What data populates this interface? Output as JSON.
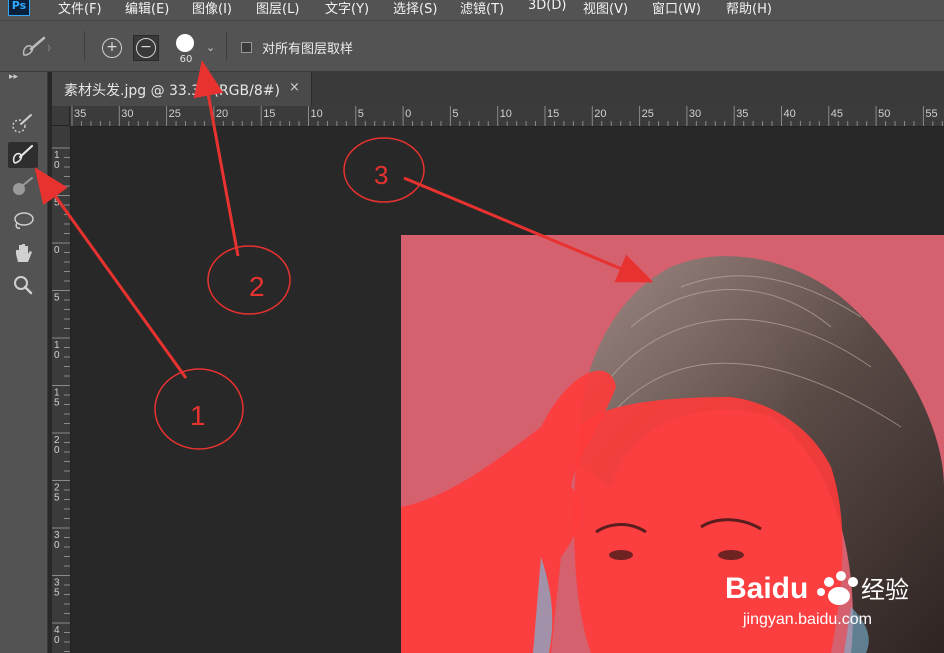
{
  "app": {
    "logo": "Ps"
  },
  "menu": [
    "文件(F)",
    "编辑(E)",
    "图像(I)",
    "图层(L)",
    "文字(Y)",
    "选择(S)",
    "滤镜(T)",
    "3D(D)",
    "视图(V)",
    "窗口(W)",
    "帮助(H)"
  ],
  "options": {
    "brush_size": "60",
    "sample_all_layers_label": "对所有图层取样",
    "sample_all_layers_checked": false
  },
  "document_tab": {
    "title": "素材头发.jpg @ 33.3%(RGB/8#)",
    "close_symbol": "×"
  },
  "rulers": {
    "top_labels": [
      "35",
      "30",
      "25",
      "20",
      "15",
      "10",
      "5",
      "0",
      "5",
      "10",
      "15",
      "20",
      "25",
      "30",
      "35",
      "40",
      "45",
      "50",
      "55"
    ],
    "left_labels": [
      "10",
      "5",
      "0",
      "5",
      "10",
      "15",
      "20",
      "25",
      "30",
      "35",
      "40"
    ]
  },
  "annotations": [
    {
      "label": "1"
    },
    {
      "label": "2"
    },
    {
      "label": "3"
    }
  ],
  "watermark": {
    "brand": "Baidu",
    "brand_cn": "经验",
    "url": "jingyan.baidu.com"
  },
  "colors": {
    "ui_panel": "#535353",
    "canvas_bg": "#282828",
    "annotation": "#e8322f",
    "quick_mask_overlay": "#ff3b3b"
  }
}
